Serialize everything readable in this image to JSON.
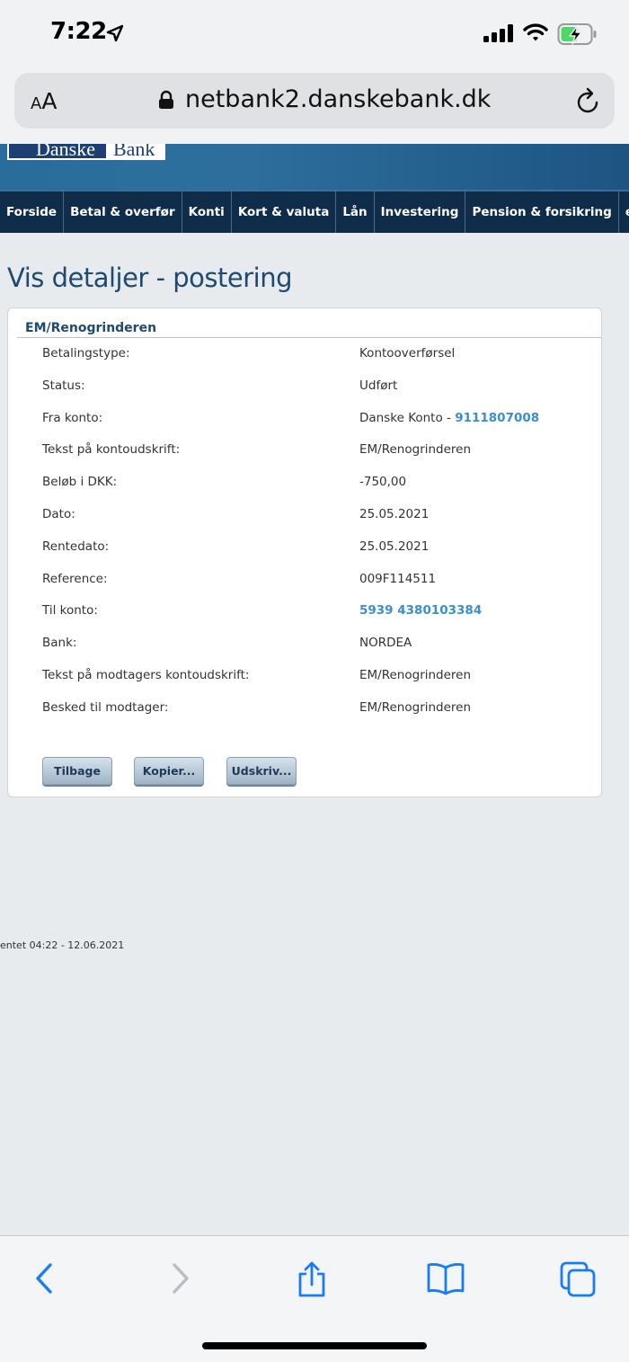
{
  "status_bar": {
    "time": "7:22",
    "icons": [
      "location-arrow-icon",
      "cellular-signal-icon",
      "wifi-icon",
      "battery-charging-icon"
    ]
  },
  "browser": {
    "aa_small": "A",
    "aa_big": "A",
    "url": "netbank2.danskebank.dk",
    "icons": [
      "lock-icon",
      "reload-icon"
    ]
  },
  "bank": {
    "logo_left": "Danske",
    "logo_right": "Bank"
  },
  "nav": {
    "items": [
      "Forside",
      "Betal & overfør",
      "Konti",
      "Kort & valuta",
      "Lån",
      "Investering",
      "Pension & forsikring",
      "e-Bo"
    ]
  },
  "page": {
    "title": "Vis detaljer - postering"
  },
  "panel": {
    "title": "EM/Renogrinderen",
    "rows": [
      {
        "label": "Betalingstype:",
        "value": "Kontooverførsel"
      },
      {
        "label": "Status:",
        "value": "Udført"
      },
      {
        "label": "Fra konto:",
        "value_prefix": "Danske Konto - ",
        "value_link": "9111807008"
      },
      {
        "label": "Tekst på kontoudskrift:",
        "value": "EM/Renogrinderen"
      },
      {
        "label": "Beløb i DKK:",
        "value": "-750,00"
      },
      {
        "label": "Dato:",
        "value": "25.05.2021"
      },
      {
        "label": "Rentedato:",
        "value": "25.05.2021"
      },
      {
        "label": "Reference:",
        "value": "009F114511"
      },
      {
        "label": "Til konto:",
        "value_link": "5939 4380103384"
      },
      {
        "label": "Bank:",
        "value": "NORDEA"
      },
      {
        "label": "Tekst på modtagers kontoudskrift:",
        "value": "EM/Renogrinderen"
      },
      {
        "label": "Besked til modtager:",
        "value": "EM/Renogrinderen"
      }
    ],
    "buttons": {
      "back": "Tilbage",
      "copy": "Kopier...",
      "print": "Udskriv..."
    }
  },
  "footer": {
    "fetched": "entet 04:22 - 12.06.2021"
  },
  "toolbar": {
    "icons": [
      "back-chevron-icon",
      "forward-chevron-icon",
      "share-icon",
      "bookmarks-icon",
      "tabs-icon"
    ]
  },
  "colors": {
    "nav_bg": "#0f2c4a",
    "header_blue": "#2a6d9c",
    "title_blue": "#1e4a72",
    "link_blue": "#3a8fcf",
    "ios_blue": "#1a7cf5"
  }
}
